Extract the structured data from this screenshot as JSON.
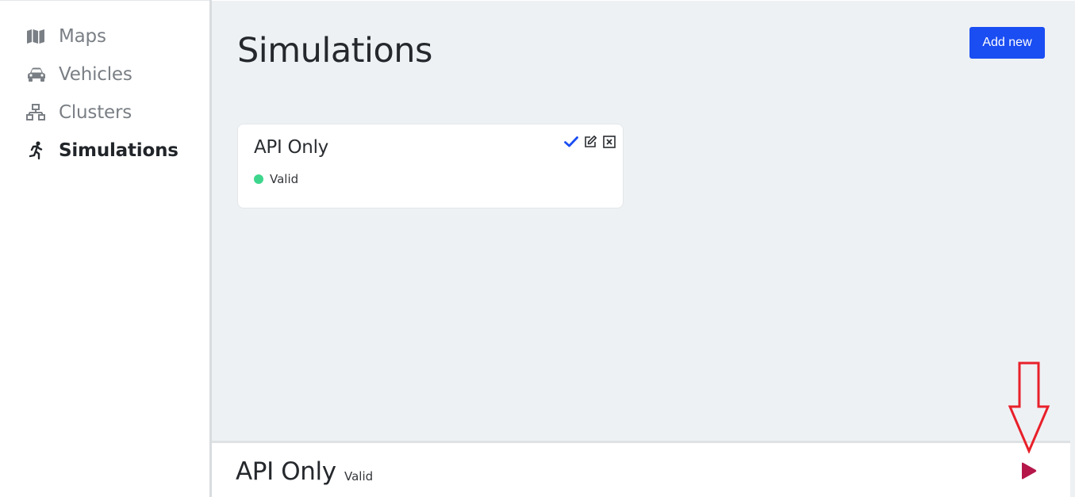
{
  "sidebar": {
    "items": [
      {
        "label": "Maps",
        "icon": "map-icon",
        "active": false
      },
      {
        "label": "Vehicles",
        "icon": "car-icon",
        "active": false
      },
      {
        "label": "Clusters",
        "icon": "sitemap-icon",
        "active": false
      },
      {
        "label": "Simulations",
        "icon": "running-person-icon",
        "active": true
      }
    ]
  },
  "main": {
    "title": "Simulations",
    "add_button_label": "Add new",
    "cards": [
      {
        "title": "API Only",
        "status": "Valid",
        "status_color": "#3dd68c",
        "actions": [
          "check-icon",
          "edit-icon",
          "close-box-icon"
        ]
      }
    ]
  },
  "bottom_panel": {
    "title": "API Only",
    "status": "Valid",
    "play_icon": "play-icon",
    "play_color": "#b5174a"
  },
  "annotation": {
    "arrow_color": "#e8202a"
  },
  "colors": {
    "accent": "#1a4df2",
    "background": "#eef1f4"
  }
}
